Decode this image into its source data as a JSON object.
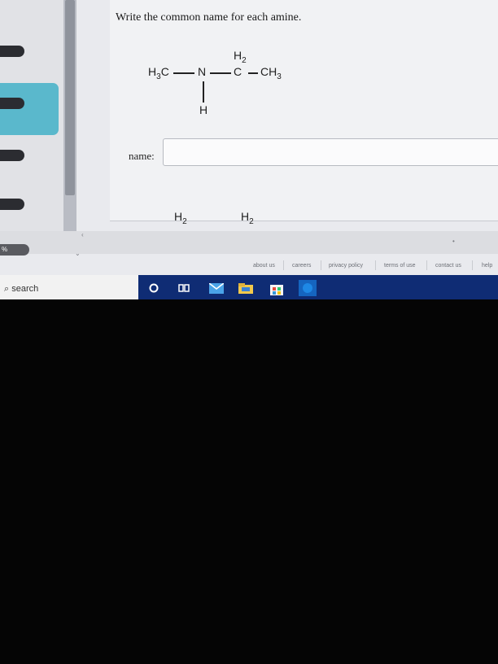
{
  "question": {
    "prompt": "Write the common name for each amine."
  },
  "structure": {
    "h2_top": "H2",
    "h3c_left": "H3C",
    "n_atom": "N",
    "c_atom": "C",
    "ch3_right": "CH3",
    "h_bottom": "H",
    "partial_h2_a": "H2",
    "partial_h2_b": "H2"
  },
  "answer": {
    "label": "name:",
    "value": ""
  },
  "sidebar": {
    "progress_text": "%"
  },
  "footer": {
    "links": [
      "about us",
      "careers",
      "privacy policy",
      "terms of use",
      "contact us",
      "help"
    ]
  },
  "taskbar": {
    "search_label": "search",
    "icons": [
      "cortana-circle-icon",
      "task-view-icon",
      "mail-icon",
      "file-explorer-icon",
      "store-icon",
      "edge-icon"
    ]
  },
  "colors": {
    "accent_sidebar": "#5ab8cc",
    "taskbar": "#0f2c74"
  }
}
